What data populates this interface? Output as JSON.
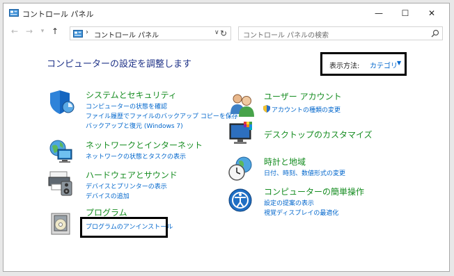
{
  "window": {
    "title": "コントロール パネル",
    "minimize": "—",
    "maximize": "☐",
    "close": "✕"
  },
  "nav": {
    "back": "←",
    "forward": "→",
    "recent": "▾",
    "up": "↑",
    "address_separator": "›",
    "address": "コントロール パネル",
    "address_dropdown": "∨",
    "refresh": "↻",
    "search_placeholder": "コントロール パネルの検索"
  },
  "heading": "コンピューターの設定を調整します",
  "view": {
    "label": "表示方法:",
    "value": "カテゴリ",
    "arrow": "▼"
  },
  "categories_left": [
    {
      "title": "システムとセキュリティ",
      "icon": "shield-icon",
      "links": [
        "コンピューターの状態を確認",
        "ファイル履歴でファイルのバックアップ コピーを保存",
        "バックアップと復元 (Windows 7)"
      ]
    },
    {
      "title": "ネットワークとインターネット",
      "icon": "network-globe-icon",
      "links": [
        "ネットワークの状態とタスクの表示"
      ]
    },
    {
      "title": "ハードウェアとサウンド",
      "icon": "printer-speaker-icon",
      "links": [
        "デバイスとプリンターの表示",
        "デバイスの追加"
      ]
    },
    {
      "title": "プログラム",
      "icon": "programs-disc-icon",
      "links": [
        "プログラムのアンインストール"
      ]
    }
  ],
  "categories_right": [
    {
      "title": "ユーザー アカウント",
      "icon": "users-icon",
      "links": [
        "アカウントの種類の変更"
      ]
    },
    {
      "title": "デスクトップのカスタマイズ",
      "icon": "monitor-icon",
      "links": []
    },
    {
      "title": "時計と地域",
      "icon": "clock-globe-icon",
      "links": [
        "日付、時刻、数値形式の変更"
      ]
    },
    {
      "title": "コンピューターの簡単操作",
      "icon": "ease-of-access-icon",
      "links": [
        "設定の提案の表示",
        "視覚ディスプレイの最適化"
      ]
    }
  ],
  "colors": {
    "heading": "#1e3287",
    "category_title": "#158c20",
    "link": "#0066cc"
  }
}
